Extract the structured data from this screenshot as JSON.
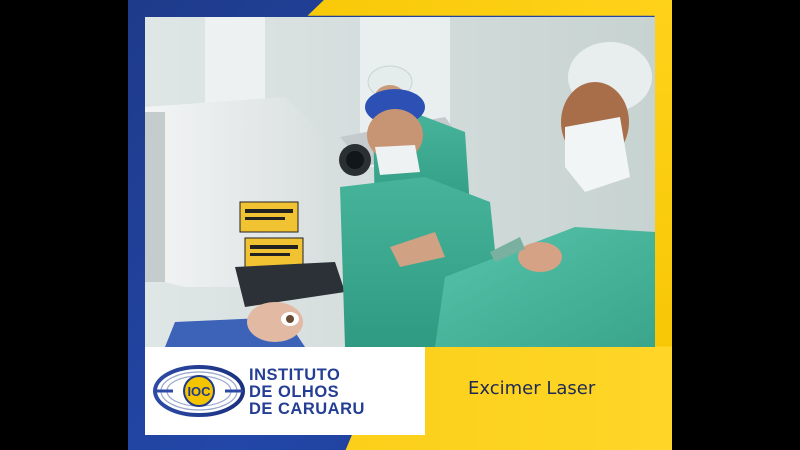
{
  "slide": {
    "logo": {
      "emblem_text": "IOC",
      "lines": [
        "INSTITUTO",
        "DE OLHOS",
        "DE CARUARU"
      ]
    },
    "caption": "Excimer Laser"
  },
  "colors": {
    "brand_blue": "#233e93",
    "brand_yellow": "#f9cb10",
    "letterbox": "#000000"
  }
}
